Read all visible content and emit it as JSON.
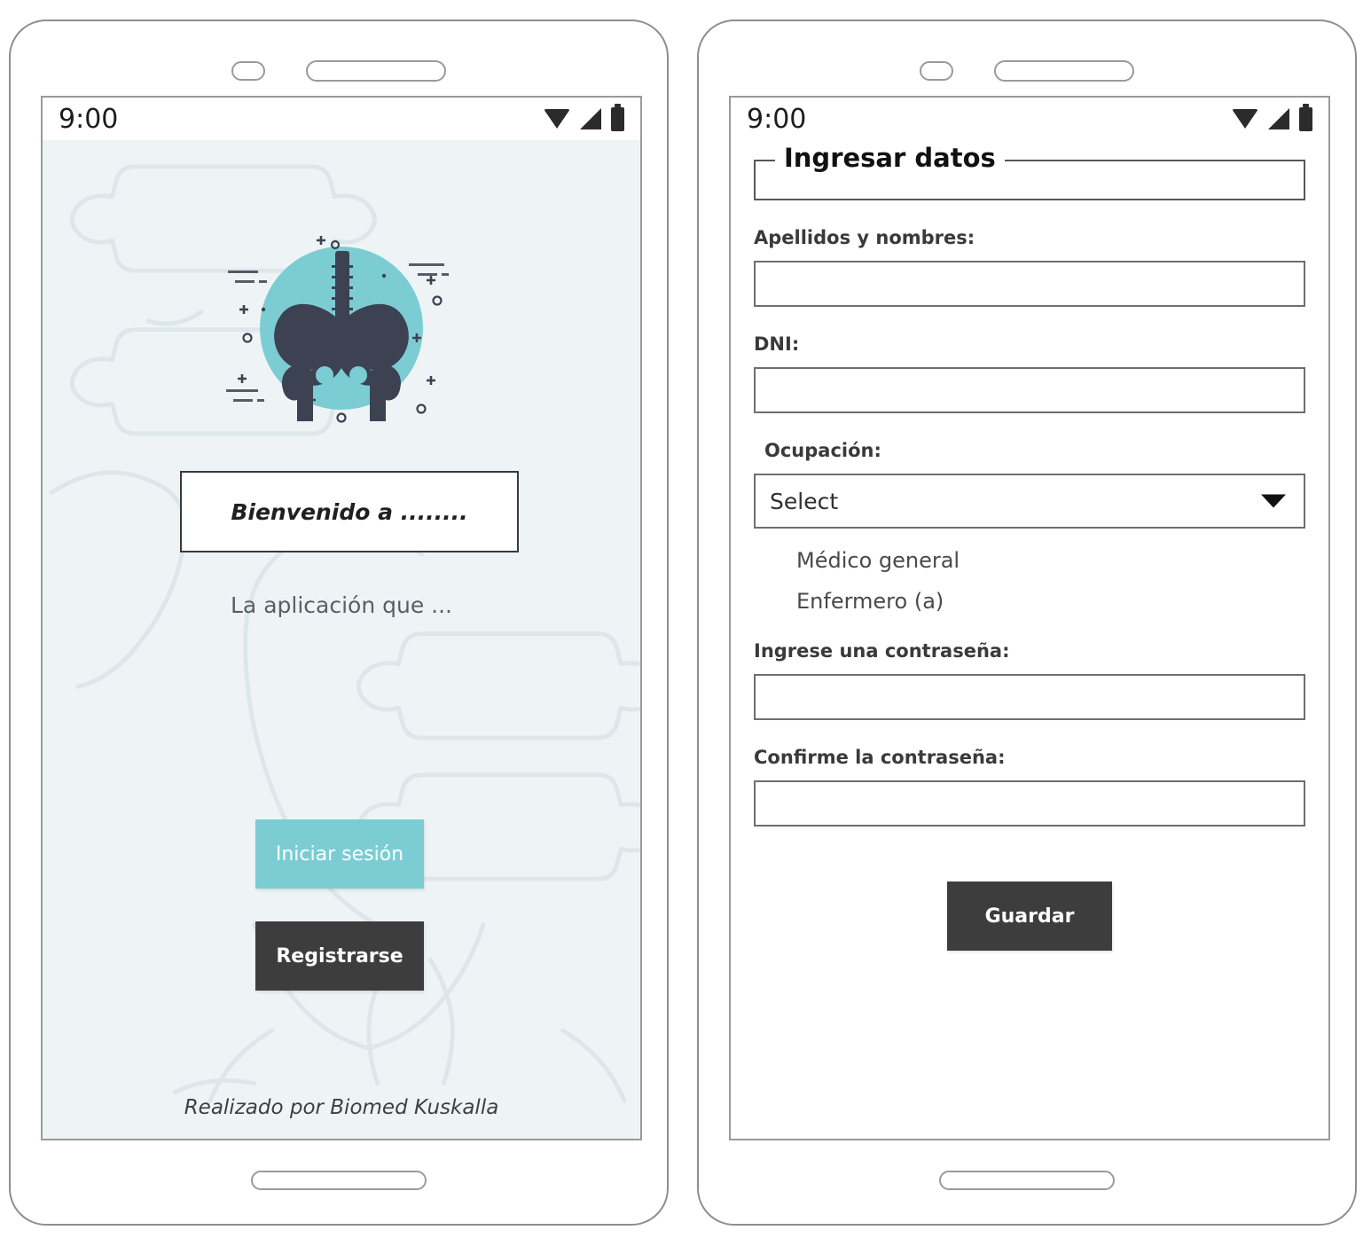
{
  "screens": [
    {
      "id": "welcome",
      "statusbar": {
        "time": "9:00",
        "icons": [
          "wifi-icon",
          "signal-icon",
          "battery-icon"
        ]
      },
      "hero": {
        "icon_name": "pelvis-bone-icon",
        "circle_color": "#7ccdd3",
        "bone_color": "#3c4251"
      },
      "welcome_title": "Bienvenido a ........",
      "subtitle": "La aplicación que ...",
      "buttons": {
        "login": "Iniciar sesión",
        "register": "Registrarse"
      },
      "footer": "Realizado por Biomed Kuskalla"
    },
    {
      "id": "register-form",
      "statusbar": {
        "time": "9:00",
        "icons": [
          "wifi-icon",
          "signal-icon",
          "battery-icon"
        ]
      },
      "legend": "Ingresar datos",
      "fields": [
        {
          "label": "Apellidos y nombres:",
          "value": "",
          "placeholder": ""
        },
        {
          "label": "DNI:",
          "value": "",
          "placeholder": ""
        }
      ],
      "occupation": {
        "label": "Ocupación:",
        "selected": "Select",
        "options": [
          "Médico general",
          "Enfermero (a)"
        ]
      },
      "passwords": [
        {
          "label": "Ingrese una contraseña:",
          "value": "",
          "placeholder": ""
        },
        {
          "label": "Confirme la contraseña:",
          "value": "",
          "placeholder": ""
        }
      ],
      "save_label": "Guardar"
    }
  ],
  "colors": {
    "accent_teal": "#7ccdd3",
    "dark": "#3d3d3d",
    "screen_bg": "#eef4f6",
    "frame": "#8e8e8e"
  }
}
